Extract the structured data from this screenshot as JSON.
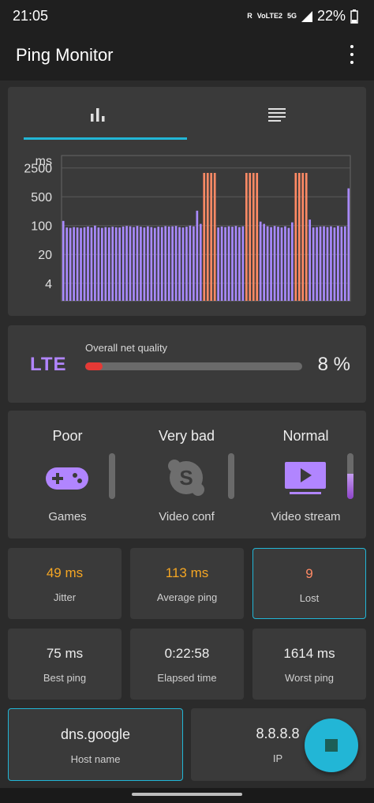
{
  "status_bar": {
    "time": "21:05",
    "network_label_1": "R",
    "network_label_2": "VoLTE2",
    "network_label_3": "5G",
    "battery": "22%"
  },
  "app": {
    "title": "Ping Monitor"
  },
  "tabs": [
    {
      "icon": "bar-chart-icon",
      "active": true
    },
    {
      "icon": "list-icon",
      "active": false
    }
  ],
  "chart_data": {
    "type": "bar",
    "ylabel": "ms",
    "y_scale": "log",
    "yticks": [
      "2500",
      "500",
      "100",
      "20",
      "4"
    ],
    "bars": [
      130,
      90,
      88,
      92,
      90,
      88,
      91,
      95,
      90,
      100,
      90,
      88,
      92,
      90,
      94,
      91,
      90,
      95,
      98,
      96,
      92,
      98,
      94,
      90,
      96,
      92,
      88,
      94,
      92,
      97,
      95,
      96,
      98,
      92,
      90,
      94,
      100,
      96,
      230,
      110,
      2500,
      2500,
      2500,
      2500,
      90,
      95,
      92,
      96,
      94,
      98,
      92,
      96,
      2500,
      2500,
      2500,
      2500,
      125,
      110,
      96,
      92,
      98,
      94,
      90,
      96,
      88,
      120,
      2500,
      2500,
      2500,
      2500,
      140,
      90,
      92,
      95,
      96,
      92,
      96,
      90,
      98,
      94,
      96,
      800
    ],
    "timeouts": [
      40,
      41,
      42,
      43,
      52,
      53,
      54,
      55,
      66,
      67,
      68,
      69
    ],
    "colors": {
      "normal": "#a98aff",
      "timeout": "#ff8a65"
    }
  },
  "quality": {
    "network_type": "LTE",
    "caption": "Overall net quality",
    "value": 0.08,
    "percent_label": "8 %"
  },
  "apps": [
    {
      "status": "Poor",
      "name": "Games",
      "icon": "gamepad-icon",
      "level": 0
    },
    {
      "status": "Very bad",
      "name": "Video conf",
      "icon": "skype-icon",
      "level": 0
    },
    {
      "status": "Normal",
      "name": "Video stream",
      "icon": "video-player-icon",
      "level": 0.55
    }
  ],
  "stats": {
    "jitter": {
      "value": "49 ms",
      "label": "Jitter"
    },
    "average": {
      "value": "113 ms",
      "label": "Average ping"
    },
    "lost": {
      "value": "9",
      "label": "Lost"
    },
    "best": {
      "value": "75 ms",
      "label": "Best ping"
    },
    "elapsed": {
      "value": "0:22:58",
      "label": "Elapsed time"
    },
    "worst": {
      "value": "1614 ms",
      "label": "Worst ping"
    }
  },
  "host": {
    "value": "dns.google",
    "label": "Host name"
  },
  "ip": {
    "value": "8.8.8.8",
    "label": "IP"
  },
  "fab": {
    "icon": "stop-icon"
  }
}
